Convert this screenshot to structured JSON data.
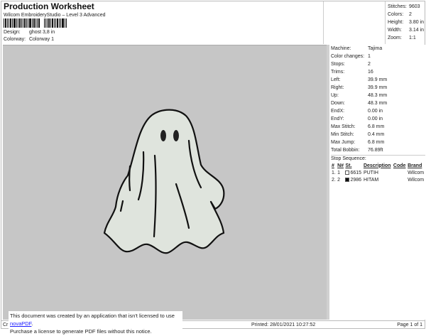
{
  "header": {
    "title": "Production Worksheet",
    "subtitle": "Wilcom EmbroideryStudio – Level 3 Advanced",
    "design_label": "Design:",
    "design_value": "ghost 3,8 in",
    "colorway_label": "Colorway:",
    "colorway_value": "Colorway 1"
  },
  "summary": [
    {
      "k": "Stitches:",
      "v": "9603"
    },
    {
      "k": "Colors:",
      "v": "2"
    },
    {
      "k": "Height:",
      "v": "3.80 in"
    },
    {
      "k": "Width:",
      "v": "3.14 in"
    },
    {
      "k": "Zoom:",
      "v": "1:1"
    }
  ],
  "details": [
    {
      "k": "Machine:",
      "v": "Tajima"
    },
    {
      "k": "Color changes:",
      "v": "1"
    },
    {
      "k": "Stops:",
      "v": "2"
    },
    {
      "k": "Trims:",
      "v": "16"
    },
    {
      "k": "Left:",
      "v": "39.9 mm"
    },
    {
      "k": "Right:",
      "v": "39.9 mm"
    },
    {
      "k": "Up:",
      "v": "48.3 mm"
    },
    {
      "k": "Down:",
      "v": "48.3 mm"
    },
    {
      "k": "EndX:",
      "v": "0.00 in"
    },
    {
      "k": "EndY:",
      "v": "0.00 in"
    },
    {
      "k": "Max Stitch:",
      "v": "6.8 mm"
    },
    {
      "k": "Min Stitch:",
      "v": "0.4 mm"
    },
    {
      "k": "Max Jump:",
      "v": "6.8 mm"
    },
    {
      "k": "Total Bobbin:",
      "v": "76.89ft"
    }
  ],
  "stop_sequence": {
    "title": "Stop Sequence:",
    "headers": [
      "#",
      "N#",
      "St.",
      "Description",
      "Code",
      "Brand"
    ],
    "rows": [
      {
        "num": "1.",
        "n": "1",
        "color": "#ffffff",
        "st": "6615",
        "desc": "PUTIH",
        "code": "",
        "brand": "Wilcom"
      },
      {
        "num": "2.",
        "n": "2",
        "color": "#111111",
        "st": "2986",
        "desc": "HITAM",
        "code": "",
        "brand": "Wilcom"
      }
    ]
  },
  "footer": {
    "left": "Cr",
    "printed": "Printed: 28/01/2021 10:27:52",
    "page": "Page 1 of 1"
  },
  "notice": {
    "line1": "This document was created by an application that isn't licensed to use ",
    "link": "novaPDF",
    "line1_end": ".",
    "line2": "Purchase a license to generate PDF files without this notice."
  }
}
